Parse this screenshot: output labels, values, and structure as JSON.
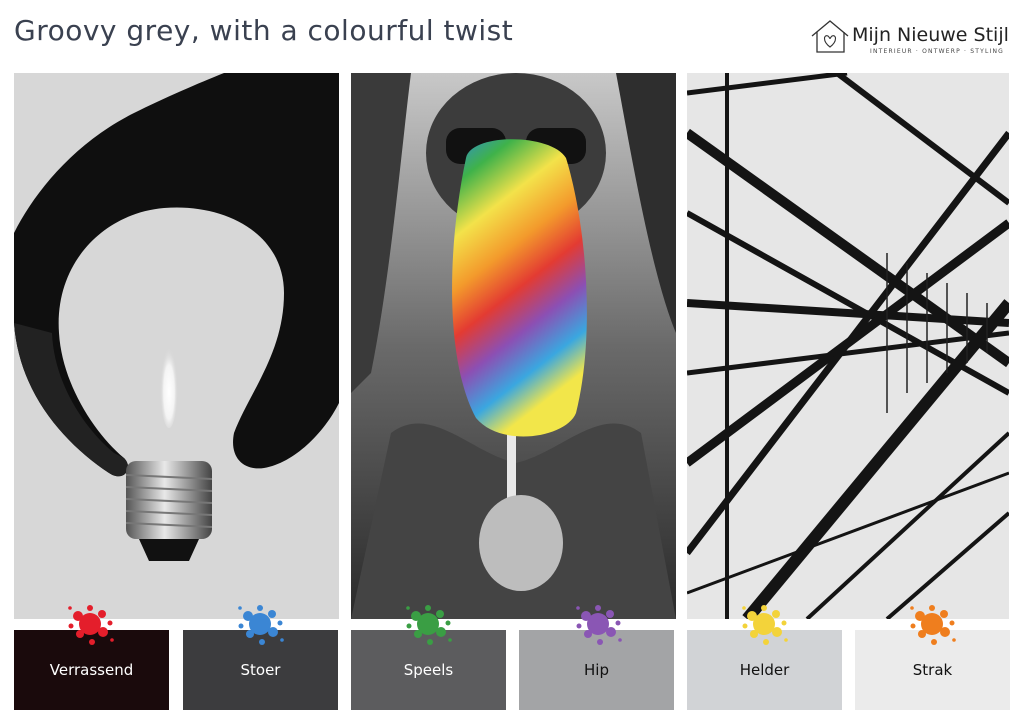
{
  "header": {
    "title": "Groovy grey, with a colourful twist"
  },
  "logo": {
    "name": "Mijn Nieuwe Stijl",
    "tagline": "INTERIEUR · ONTWERP · STYLING"
  },
  "images": [
    {
      "subject": "hand holding light bulb with flame"
    },
    {
      "subject": "woman holding rainbow popsicle"
    },
    {
      "subject": "steel construction abstract lines"
    }
  ],
  "swatches": [
    {
      "label": "Verrassend",
      "color": "#1a0a0c",
      "text_color": "#ffffff",
      "splash_color": "#e41e2b"
    },
    {
      "label": "Stoer",
      "color": "#3c3c3e",
      "text_color": "#ffffff",
      "splash_color": "#3b86d4"
    },
    {
      "label": "Speels",
      "color": "#5c5c5e",
      "text_color": "#ffffff",
      "splash_color": "#3a9e44"
    },
    {
      "label": "Hip",
      "color": "#a3a4a6",
      "text_color": "#111111",
      "splash_color": "#8a56b4"
    },
    {
      "label": "Helder",
      "color": "#d1d3d6",
      "text_color": "#111111",
      "splash_color": "#f3d33a"
    },
    {
      "label": "Strak",
      "color": "#ebebeb",
      "text_color": "#111111",
      "splash_color": "#ef7e1e"
    }
  ]
}
